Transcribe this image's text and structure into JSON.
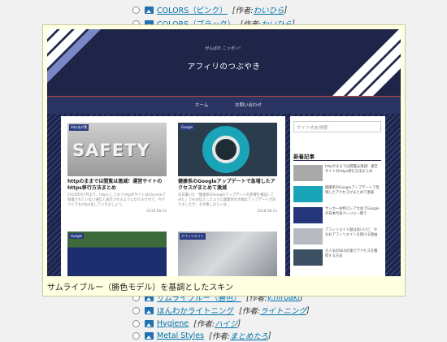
{
  "skins_above": [
    {
      "name": "COLORS（ピンク）",
      "author_label": "[作者:",
      "author": "わいひら",
      "close": "]"
    },
    {
      "name": "COLORS（ブラック）",
      "author_label": "[作者:",
      "author": "わいひら",
      "close": "]"
    }
  ],
  "skins_below": [
    {
      "name": "サムライブルー（勝色）",
      "author_label": "[作者:",
      "author": "y.hiroaki",
      "close": "]"
    },
    {
      "name": "ほんわかライトニング",
      "author_label": "[作者:",
      "author": "ライトニング",
      "close": "]"
    },
    {
      "name": "Hygiene",
      "author_label": "[作者:",
      "author": "ハイジ",
      "close": "]"
    },
    {
      "name": "Metal Styles",
      "author_label": "[作者:",
      "author": "まとめたろ",
      "close": "]"
    }
  ],
  "tooltip": {
    "caption": "サムライブルー（勝色モデル）を基調としたスキン",
    "preview": {
      "tagline": "がんばれ ニッポン！",
      "site_title": "アフィリのつぶやき",
      "menu": [
        "ホーム",
        "お問い合わせ"
      ],
      "cards": [
        {
          "category": "http化対策",
          "title": "httpのままでは閲覧は激減！運営サイトのhttps移行方法まとめ",
          "excerpt": "2018年の7月より、httpにしておくhttpのサイトはChromeで保護されていない通信と表示されるようになりますので、今すぐにでもhttps化していきましょう。",
          "date": "2018.08.24"
        },
        {
          "category": "Google",
          "title": "健康系のGoogleアップデートで急増したアクセスがまとめて激減",
          "excerpt": "先日書いた「健康系のGoogleアップデートの影響を検証してみた」でもお伝えしたように健康系の大幅なアップデートがありましたが、その後しばらくは…",
          "date": "2018.08.23"
        },
        {
          "category": "Google",
          "title": "",
          "excerpt": "",
          "date": ""
        },
        {
          "category": "アフィリエイト",
          "title": "",
          "excerpt": "",
          "date": ""
        }
      ],
      "thumb_text": "SAFETY",
      "search_placeholder": "サイト内を検索",
      "recent_heading": "新着記事",
      "recent": [
        "httpのままでは閲覧は激減！運営サイトのhttps移行方法まとめ",
        "健康系のGoogleアップデートで急増したアクセスがまとめて激減",
        "サッカーW杯ロシア大会でGoogleの日本代表ページに一瞬で",
        "アフィリエイト歴は長いけど、今なおアフィリエイトを続ける理由",
        "大人気のSEO対策でアクセスを獲得する方法"
      ]
    }
  },
  "colors": {
    "accent": "#0073aa",
    "header": "#1e2548",
    "menu": "#2a3563",
    "tooltip_bg": "#ffffe1"
  }
}
